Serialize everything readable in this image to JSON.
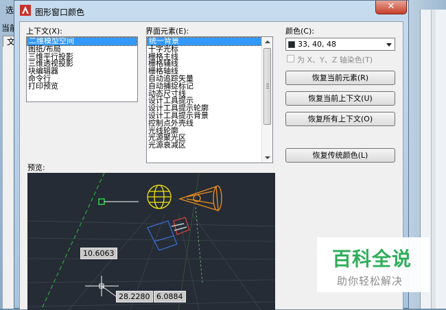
{
  "background": {
    "window_title": "选",
    "current_label": "当前",
    "tab_label": "文"
  },
  "dialog": {
    "title": "图形窗口颜色",
    "close_symbol": "✕"
  },
  "context": {
    "label": "上下文(X):",
    "items": [
      "二维模型空间",
      "图纸/布局",
      "三维平行投影",
      "三维透视投影",
      "块编辑器",
      "命令行",
      "打印预览"
    ],
    "selected_index": 0
  },
  "interface": {
    "label": "界面元素(E):",
    "items": [
      "统一背景",
      "十字光标",
      "栅格主线",
      "栅格辅线",
      "栅格轴线",
      "自动追踪矢量",
      "自动捕捉标记",
      "动态尺寸线",
      "设计工具提示",
      "设计工具提示轮廓",
      "设计工具提示背景",
      "控制点外壳线",
      "光线轮廓",
      "光源聚光区",
      "光源衰减区"
    ],
    "selected_index": 0
  },
  "color": {
    "label": "颜色(C):",
    "value": "33, 40, 48",
    "swatch": "#21282f",
    "tint_label": "为 X、Y、Z 轴染色(T)",
    "tint_checked": false
  },
  "buttons": {
    "restore_element": "恢复当前元素(R)",
    "restore_context": "恢复当前上下文(U)",
    "restore_all": "恢复所有上下文(O)",
    "restore_classic": "恢复传统颜色(L)"
  },
  "preview": {
    "label": "预览:",
    "dim_values": [
      "10.6063",
      "28.2280",
      "6.0884"
    ]
  },
  "watermark": {
    "title": "百科全说",
    "subtitle": "助你轻松解决"
  }
}
